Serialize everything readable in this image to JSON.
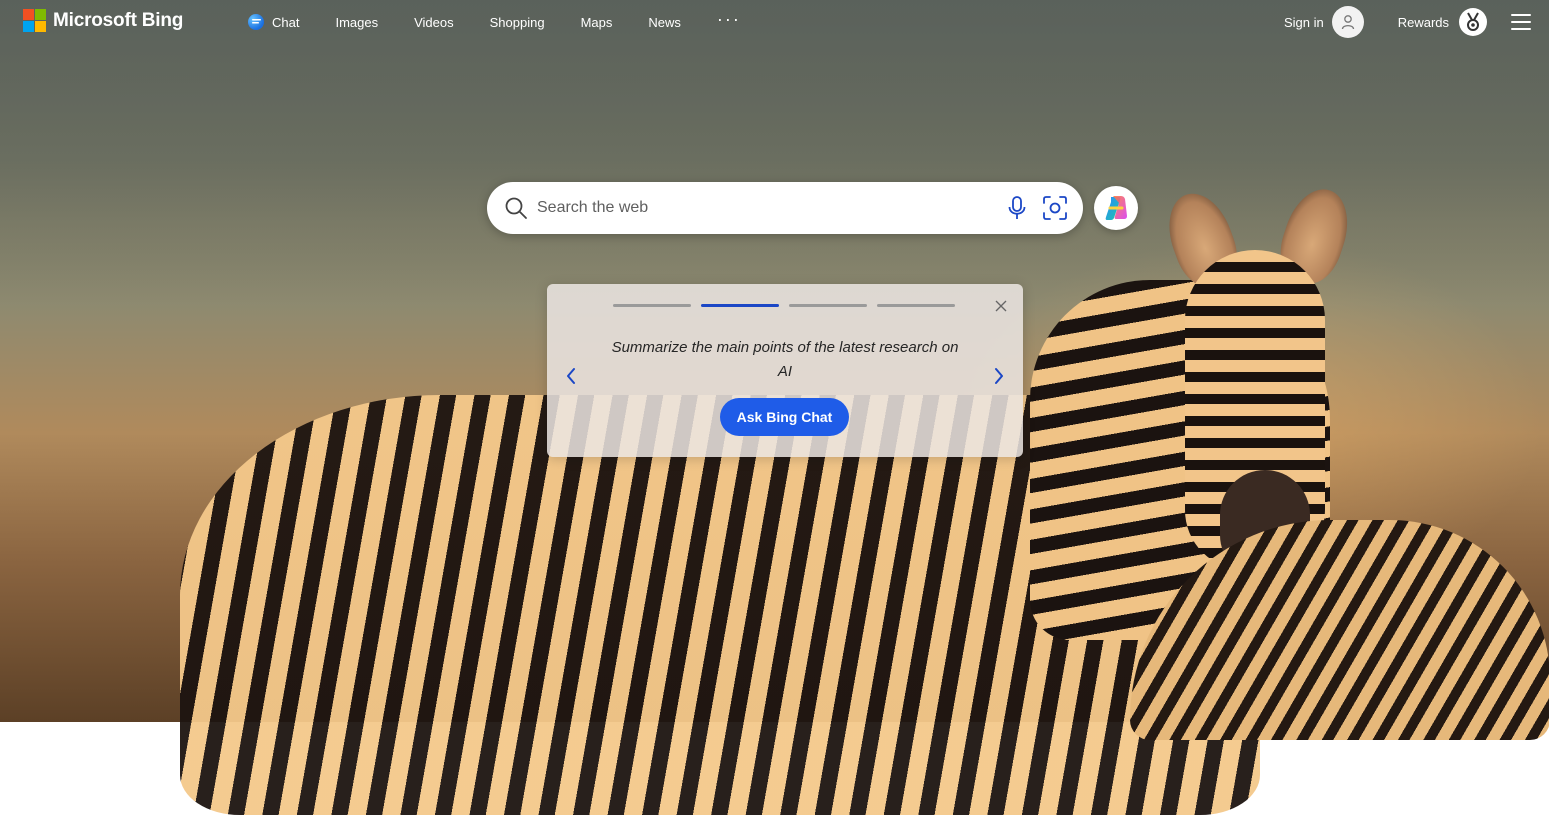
{
  "brand": {
    "name": "Microsoft Bing",
    "logo_colors": [
      "#f25022",
      "#7fba00",
      "#00a4ef",
      "#ffb900"
    ]
  },
  "nav": {
    "items": [
      {
        "label": "Chat",
        "icon": "chat-icon"
      },
      {
        "label": "Images"
      },
      {
        "label": "Videos"
      },
      {
        "label": "Shopping"
      },
      {
        "label": "Maps"
      },
      {
        "label": "News"
      }
    ],
    "more_label": "···"
  },
  "header_right": {
    "sign_in_label": "Sign in",
    "rewards_label": "Rewards"
  },
  "search": {
    "placeholder": "Search the web",
    "value": ""
  },
  "suggestion_card": {
    "text": "Summarize the main points of the latest research on AI",
    "button_label": "Ask Bing Chat",
    "total_steps": 4,
    "active_step": 2
  },
  "colors": {
    "accent": "#1f5ce8",
    "progress_active": "#1b47c6",
    "progress_inactive": "#9a9a9a",
    "icon_blue": "#1b47c6"
  }
}
